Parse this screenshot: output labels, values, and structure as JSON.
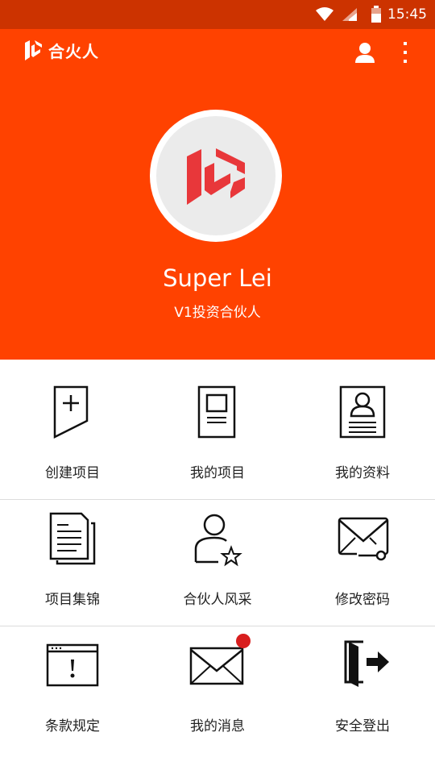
{
  "status_bar": {
    "time": "15:45"
  },
  "app_bar": {
    "title": "合火人"
  },
  "profile": {
    "name": "Super Lei",
    "role": "V1投资合伙人"
  },
  "menu": [
    {
      "label": "创建项目",
      "icon": "create-project-icon"
    },
    {
      "label": "我的项目",
      "icon": "my-project-icon"
    },
    {
      "label": "我的资料",
      "icon": "my-profile-icon"
    },
    {
      "label": "项目集锦",
      "icon": "project-collection-icon"
    },
    {
      "label": "合伙人风采",
      "icon": "partner-showcase-icon"
    },
    {
      "label": "修改密码",
      "icon": "change-password-icon"
    },
    {
      "label": "条款规定",
      "icon": "terms-icon"
    },
    {
      "label": "我的消息",
      "icon": "messages-icon",
      "has_unread": true
    },
    {
      "label": "安全登出",
      "icon": "logout-icon"
    }
  ],
  "colors": {
    "status_bar": "#cc3300",
    "header": "#ff4200",
    "badge": "#d81e1e",
    "logo_red": "#e8373a"
  }
}
